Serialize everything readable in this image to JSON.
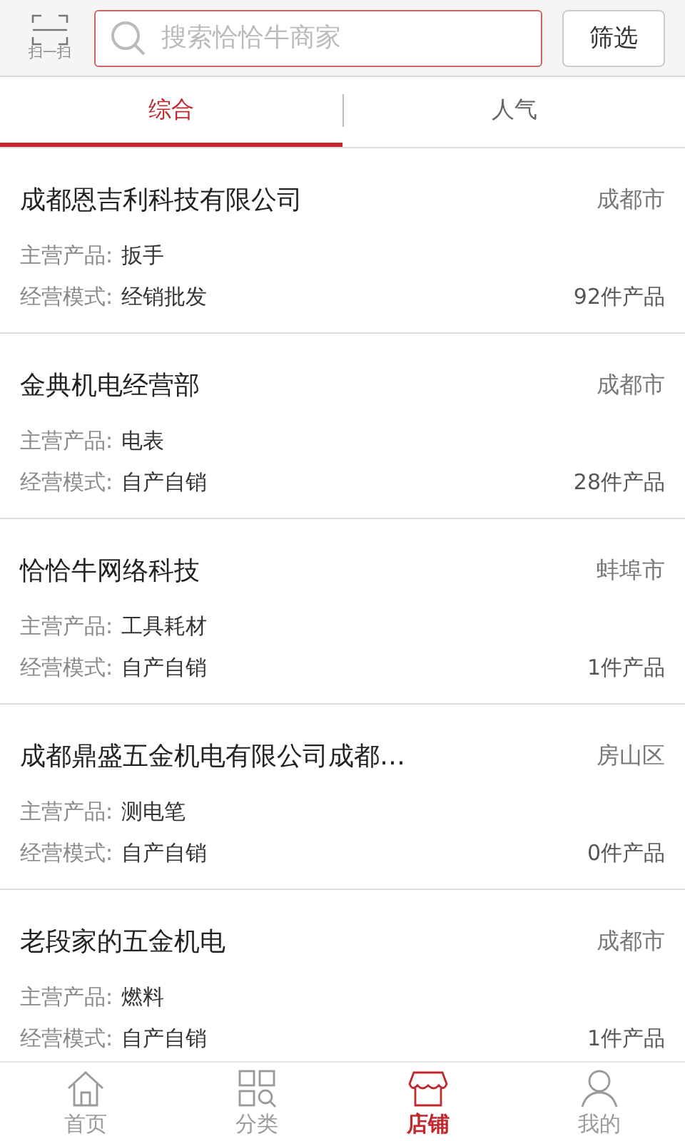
{
  "header": {
    "scan_label": "扫一扫",
    "search": {
      "placeholder": "搜索恰恰牛商家"
    },
    "filter_button": "筛选"
  },
  "tabs": [
    {
      "label": "综合",
      "selected": true
    },
    {
      "label": "人气",
      "selected": false
    }
  ],
  "shops": [
    {
      "name": "成都恩吉利科技有限公司",
      "city": "成都市",
      "product_label": "主营产品:",
      "product": "扳手",
      "mode_label": "经营模式:",
      "mode": "经销批发",
      "count": "92件产品"
    },
    {
      "name": "金典机电经营部",
      "city": "成都市",
      "product_label": "主营产品:",
      "product": "电表",
      "mode_label": "经营模式:",
      "mode": "自产自销",
      "count": "28件产品"
    },
    {
      "name": "恰恰牛网络科技",
      "city": "蚌埠市",
      "product_label": "主营产品:",
      "product": "工具耗材",
      "mode_label": "经营模式:",
      "mode": "自产自销",
      "count": "1件产品"
    },
    {
      "name": "成都鼎盛五金机电有限公司成都…",
      "city": "房山区",
      "product_label": "主营产品:",
      "product": "测电笔",
      "mode_label": "经营模式:",
      "mode": "自产自销",
      "count": "0件产品"
    },
    {
      "name": "老段家的五金机电",
      "city": "成都市",
      "product_label": "主营产品:",
      "product": "燃料",
      "mode_label": "经营模式:",
      "mode": "自产自销",
      "count": "1件产品"
    }
  ],
  "bottom_nav": [
    {
      "kind": "home",
      "label": "首页",
      "selected": false
    },
    {
      "kind": "category",
      "label": "分类",
      "selected": false
    },
    {
      "kind": "store",
      "label": "店铺",
      "selected": true
    },
    {
      "kind": "profile",
      "label": "我的",
      "selected": false
    }
  ]
}
